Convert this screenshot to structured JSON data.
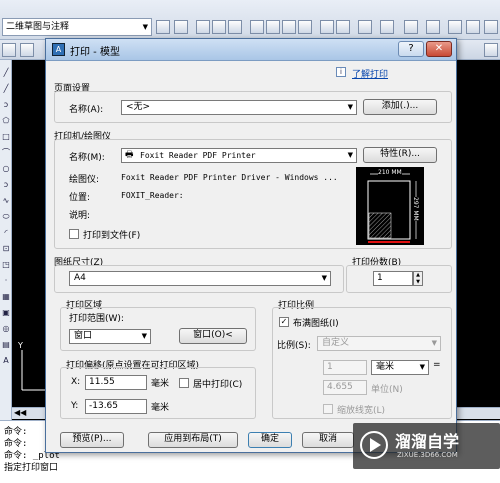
{
  "app": {
    "workspace": "二维草图与注释",
    "command_history": [
      "命令:",
      "命令:",
      "命令:  _plot",
      "指定打印窗口"
    ]
  },
  "dialog": {
    "title": "打印 - 模型",
    "help_link": "了解打印",
    "help_button": "?",
    "close_button": "✕",
    "page_setup": {
      "section": "页面设置",
      "name_label": "名称(A):",
      "name_value": "<无>",
      "add_button": "添加(.)..."
    },
    "printer": {
      "section": "打印机/绘图仪",
      "name_label": "名称(M):",
      "name_value": "Foxit Reader PDF Printer",
      "properties_button": "特性(R)...",
      "plotter_label": "绘图仪:",
      "plotter_value": "Foxit Reader PDF Printer Driver - Windows ...",
      "where_label": "位置:",
      "where_value": "FOXIT_Reader:",
      "description_label": "说明:",
      "print_to_file": "打印到文件(F)",
      "preview_width": "210 MM",
      "preview_height": "297 MM"
    },
    "paper_size": {
      "section": "图纸尺寸(Z)",
      "value": "A4"
    },
    "copies": {
      "section": "打印份数(B)",
      "value": "1"
    },
    "plot_area": {
      "section": "打印区域",
      "what_label": "打印范围(W):",
      "what_value": "窗口",
      "window_button": "窗口(O)<"
    },
    "plot_offset": {
      "section": "打印偏移(原点设置在可打印区域)",
      "x_label": "X:",
      "x_value": "11.55",
      "y_label": "Y:",
      "y_value": "-13.65",
      "unit": "毫米",
      "center_label": "居中打印(C)"
    },
    "plot_scale": {
      "section": "打印比例",
      "fit_label": "布满图纸(I)",
      "fit_checked": true,
      "scale_label": "比例(S):",
      "scale_value": "自定义",
      "value1": "1",
      "units_value": "毫米",
      "value2": "4.655",
      "units_label": "单位(N)",
      "lineweights_label": "缩放线宽(L)"
    },
    "footer": {
      "preview_button": "预览(P)...",
      "apply_button": "应用到布局(T)",
      "ok_button": "确定",
      "cancel_button": "取消"
    }
  },
  "watermark": {
    "brand": "溜溜自学",
    "url": "ZIXUE.3D66.COM"
  },
  "colors": {
    "canvas": "#000000",
    "dialog_bg": "#f0f0f0",
    "title_bar": "#b9d1ea",
    "close_button": "#c84a35",
    "link": "#0645ad"
  }
}
